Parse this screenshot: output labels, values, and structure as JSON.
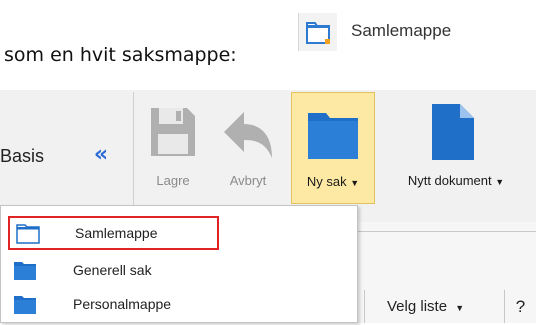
{
  "intro": {
    "text": "som en hvit saksmappe:",
    "folder_label": "Samlemappe"
  },
  "ribbon": {
    "section_label": "Basis",
    "collapse_glyph": "«",
    "buttons": [
      {
        "label": "Lagre",
        "icon": "save-icon",
        "enabled": false
      },
      {
        "label": "Avbryt",
        "icon": "undo-icon",
        "enabled": false
      },
      {
        "label": "Ny sak",
        "icon": "folder-icon",
        "enabled": true,
        "dropdown": true,
        "active": true
      },
      {
        "label": "Nytt dokument",
        "icon": "document-icon",
        "enabled": true,
        "dropdown": true
      }
    ]
  },
  "statusbar": {
    "velg_liste": "Velg liste",
    "help": "?"
  },
  "menu": {
    "items": [
      {
        "label": "Samlemappe",
        "icon": "white-folder-icon",
        "highlighted": true
      },
      {
        "label": "Generell sak",
        "icon": "folder-icon"
      },
      {
        "label": "Personalmappe",
        "icon": "folder-icon"
      }
    ]
  },
  "colors": {
    "accent_blue": "#1a73c9",
    "active_button": "#fde9a4",
    "highlight_border": "#e02424",
    "disabled_gray": "#a8a8a8"
  }
}
